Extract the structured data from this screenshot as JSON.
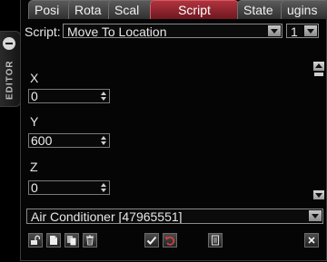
{
  "side_panel": {
    "label": "EDITOR",
    "collapse_icon": "minus-circle-icon"
  },
  "tabs": [
    {
      "label": "Posi",
      "active": false
    },
    {
      "label": "Rota",
      "active": false
    },
    {
      "label": "Scal",
      "active": false
    },
    {
      "label": "Script",
      "active": true
    },
    {
      "label": "State",
      "active": false
    },
    {
      "label": "ugins",
      "active": false
    }
  ],
  "script": {
    "label": "Script:",
    "selected": "Move To Location",
    "index_selected": "1"
  },
  "fields": [
    {
      "label": "X",
      "value": "0"
    },
    {
      "label": "Y",
      "value": "600"
    },
    {
      "label": "Z",
      "value": "0"
    }
  ],
  "object_selector": {
    "selected": "Air Conditioner [47965551]"
  },
  "toolbar": {
    "icons": [
      "open-lock-icon",
      "new-page-icon",
      "copy-pages-icon",
      "trash-icon",
      "check-icon",
      "undo-icon",
      "document-icon",
      "close-icon"
    ]
  },
  "colors": {
    "active_tab": "#9e2a34",
    "border": "#7a7a7a",
    "background": "#000000"
  }
}
